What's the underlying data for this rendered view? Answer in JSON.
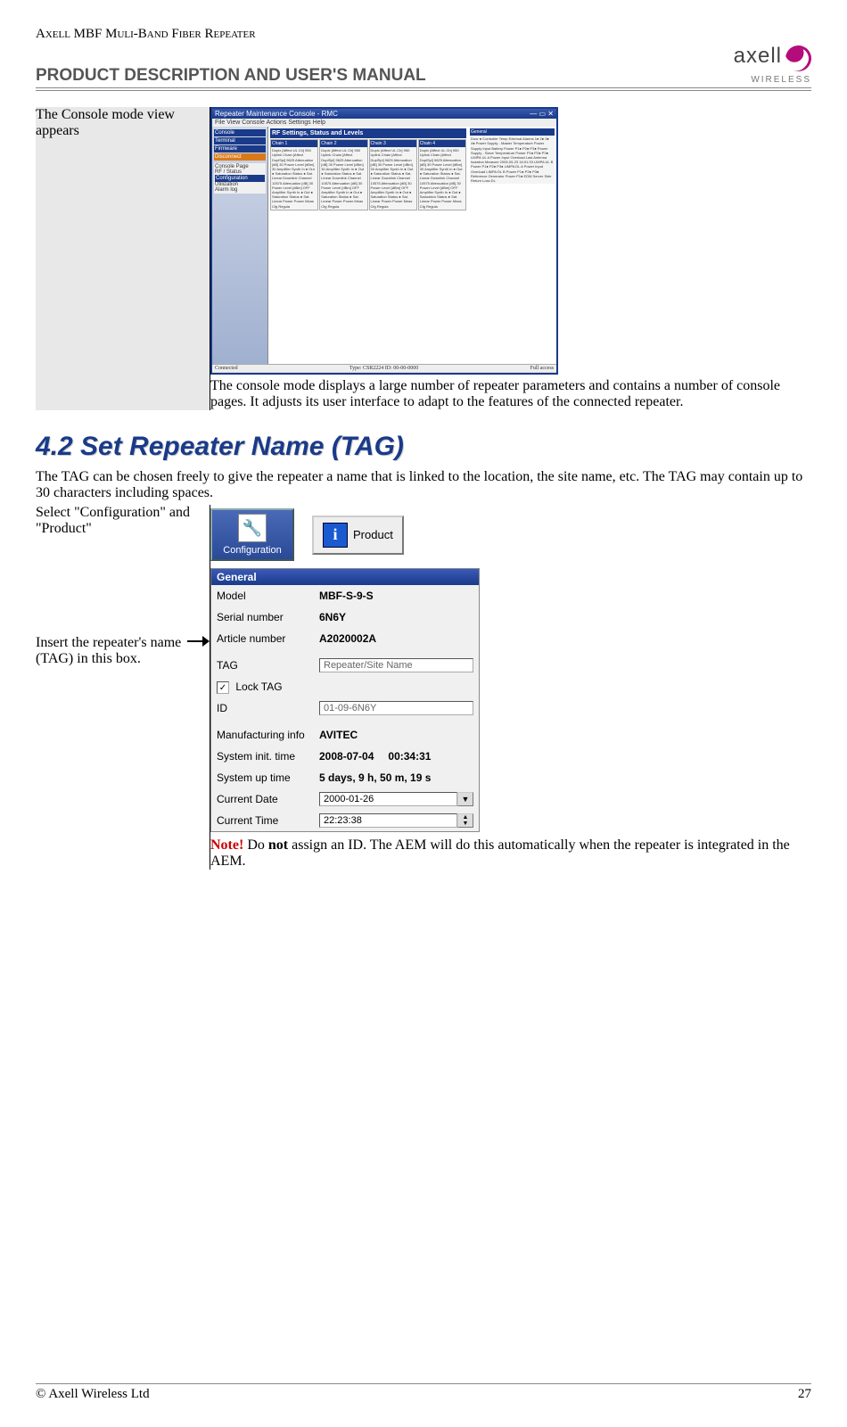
{
  "header": {
    "small": "Axell MBF Muli-Band Fiber Repeater",
    "title": "PRODUCT DESCRIPTION AND USER'S MANUAL",
    "logo_top": "axell",
    "logo_bottom": "WIRELESS"
  },
  "section1": {
    "left": "The Console mode view appears",
    "caption": "The console mode displays a large number of repeater parameters and contains a number of console pages. It adjusts its user interface to adapt to the features of the connected repeater."
  },
  "rmc": {
    "title": "Repeater Maintenance Console - RMC",
    "menu": "File  View  Console  Actions  Settings  Help",
    "sidebar": {
      "items": [
        "Console",
        "Terminal",
        "Firmware"
      ],
      "disconnect": "Disconnect",
      "pane_label": "Console Page",
      "pages": [
        "RF / Status",
        "Configuration",
        "Utilization",
        "Alarm log"
      ]
    },
    "main_heading": "RF Settings, Status and Levels",
    "chains": [
      "Chain 1",
      "Chain 2",
      "Chain 3",
      "Chain 4"
    ],
    "chain_body": "Duplx [Affect UL Ch]\n950\nUplink\nChain [Affect DuplSpl]\n9625\nAttenuation [dB]\n30\nPower Level [dBm]\n30\nAmplifier\nSynth  In ● Out ●\nSaturation Status ●\nSat. Linear\nDownlink\nChannel\n10575\nAttenuation [dB]\n30\nPower Level [dBm]\nOFF\nAmplifier\nSynth  In ● Out ●\nSaturation Status ●\nSat. Linear\nPower\nPower Meas Cfg\nRegula",
    "general": {
      "heading": "General",
      "rows": "Door ● Controller Temp\nExternal Alarms 1● 2● 3● 4●\nPower Supply - Master\nTemperature\nPower Supply Input\nBattery\nPower P1● P2● P3●\nPower Supply - Slave\nTemperature\nPower P1● P2● P3●\nLIMPA UL A\nPower\nInput Overload\nLast Antenna Isolation Measure\n2005-05-23  16:01:33\nLIMPA UL B\nPower P1● P2● P3●\nLIMPA DL A\nPower\nInput Overload\nLIMPA DL B\nPower P1● P2● P3●\nReference Generator\nPower P1●\nEDM Server Side\nReturn Loss DL"
    },
    "status": {
      "left": "Connected",
      "mid": "Type: CSR2224        ID: 00-00-0000",
      "right": "Full access"
    }
  },
  "section_heading": "4.2  Set Repeater Name (TAG)",
  "section2_intro": "The TAG can be chosen freely to give the repeater a name that is linked to the location, the site name, etc. The TAG may contain up to 30 characters including spaces.",
  "section2": {
    "left1": "Select \"Configuration\" and \"Product\"",
    "left2": "Insert the repeater's name (TAG) in this box.",
    "config_label": "Configuration",
    "product_label": "Product",
    "note_prefix": "Note!",
    "note_text_1": " Do ",
    "note_bold": "not",
    "note_text_2": " assign an ID. The AEM will do this automatically when the repeater is integrated in the AEM."
  },
  "general_panel": {
    "heading": "General",
    "rows": {
      "model_l": "Model",
      "model_v": "MBF-S-9-S",
      "serial_l": "Serial number",
      "serial_v": "6N6Y",
      "article_l": "Article number",
      "article_v": "A2020002A",
      "tag_l": "TAG",
      "tag_v": "Repeater/Site Name",
      "lock_l": "Lock TAG",
      "id_l": "ID",
      "id_v": "01-09-6N6Y",
      "mfg_l": "Manufacturing info",
      "mfg_v": "AVITEC",
      "init_l": "System init. time",
      "init_v1": "2008-07-04",
      "init_v2": "00:34:31",
      "up_l": "System up time",
      "up_v": "5 days, 9 h, 50 m, 19 s",
      "date_l": "Current Date",
      "date_v": "2000-01-26",
      "time_l": "Current Time",
      "time_v": "22:23:38"
    }
  },
  "footer": {
    "left": "© Axell Wireless Ltd",
    "right": "27"
  }
}
